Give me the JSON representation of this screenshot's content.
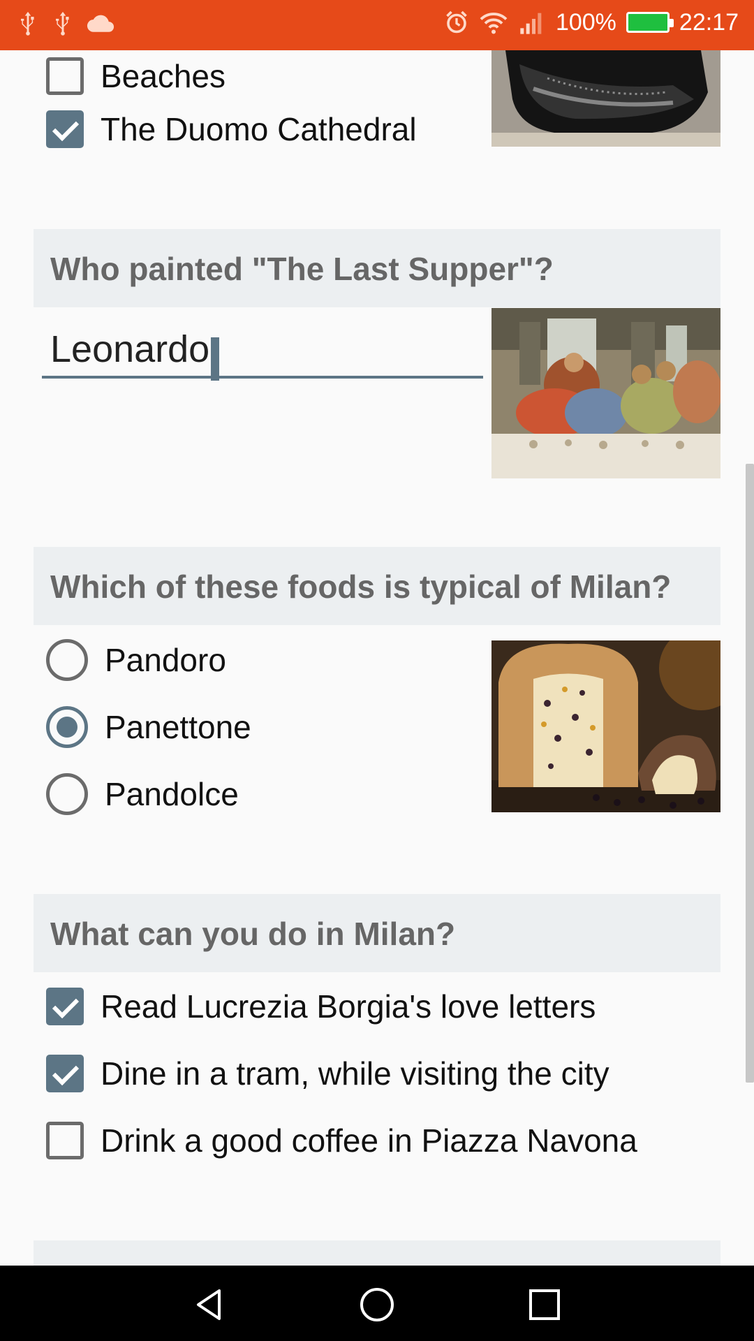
{
  "status_bar": {
    "battery_percent": "100%",
    "time": "22:17",
    "left_icons": [
      "usb-icon",
      "usb-icon",
      "cloud-icon"
    ],
    "right_icons": [
      "alarm-icon",
      "wifi-icon",
      "signal-icon",
      "battery-icon"
    ],
    "color": "#e64a19"
  },
  "question_prev": {
    "options": [
      {
        "label": "Beaches",
        "checked": false
      },
      {
        "label": "The Duomo Cathedral",
        "checked": true
      }
    ]
  },
  "question_painter": {
    "title": "Who painted \"The Last Supper\"?",
    "answer_value": "Leonardo"
  },
  "question_food": {
    "title": "Which of these foods is typical of Milan?",
    "options": [
      {
        "label": "Pandoro",
        "selected": false
      },
      {
        "label": "Panettone",
        "selected": true
      },
      {
        "label": "Pandolce",
        "selected": false
      }
    ]
  },
  "question_activities": {
    "title": "What can you do in Milan?",
    "options": [
      {
        "label": "Read Lucrezia Borgia's love letters",
        "checked": true
      },
      {
        "label": "Dine in a tram, while visiting the city",
        "checked": true
      },
      {
        "label": "Drink a good coffee in Piazza Navona",
        "checked": false
      }
    ]
  },
  "nav_bar": {
    "buttons": [
      "back-icon",
      "home-icon",
      "recents-icon"
    ]
  },
  "colors": {
    "accent": "#5c7585",
    "header_bg": "#eceff1",
    "header_text": "#666666"
  }
}
